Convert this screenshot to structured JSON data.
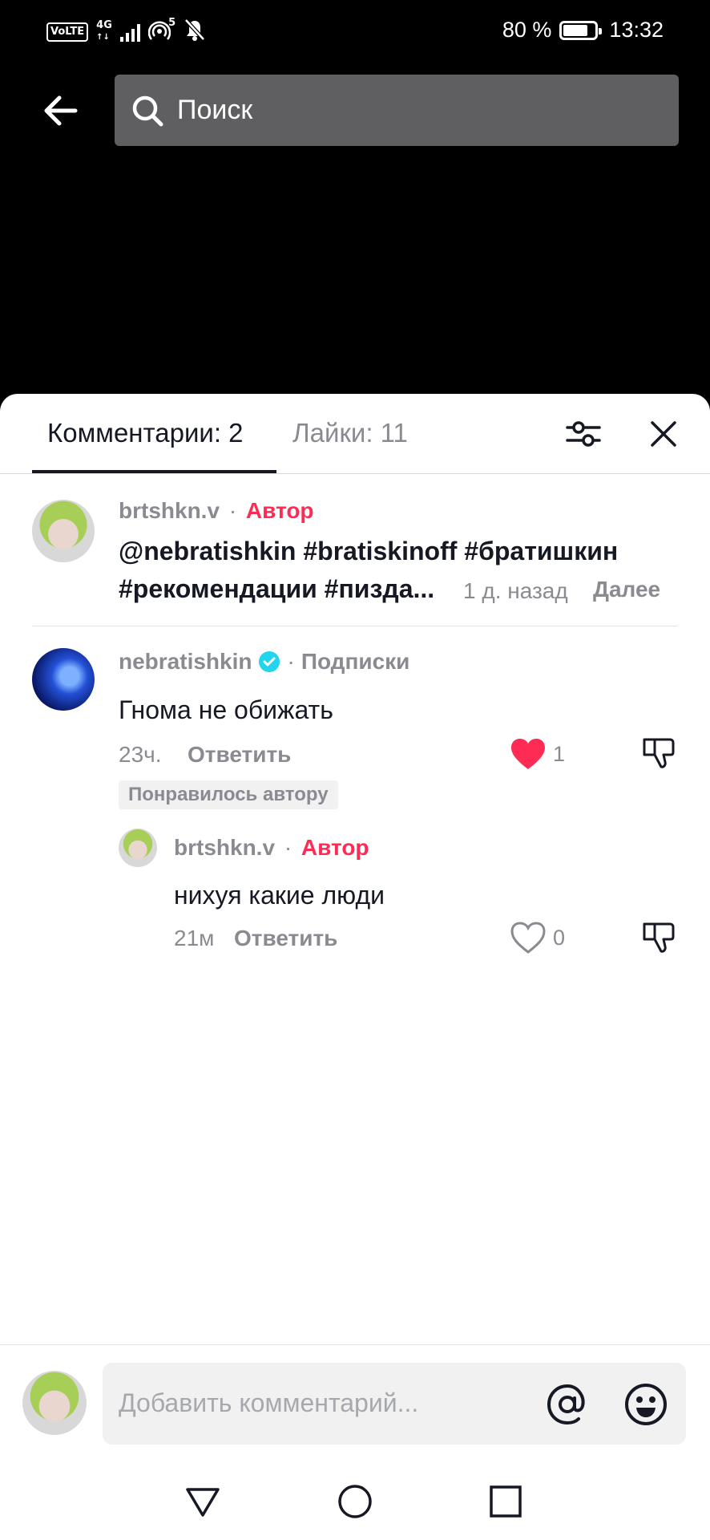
{
  "status_bar": {
    "volte": "VoLTE",
    "network": "4G",
    "hotspot_count": "5",
    "battery_percent": "80 %",
    "time": "13:32"
  },
  "search": {
    "placeholder": "Поиск"
  },
  "tabs": {
    "comments": "Комментарии: 2",
    "likes": "Лайки: 11"
  },
  "caption": {
    "username": "brtshkn.v",
    "separator": "·",
    "author_label": "Автор",
    "line1": "@nebratishkin #bratiskinoff #братишкин",
    "line2": "#рекомендации #пизда...",
    "time": "1 д. назад",
    "more": "Далее"
  },
  "comments": [
    {
      "username": "nebratishkin",
      "verified": true,
      "separator": "·",
      "relation": "Подписки",
      "text": "Гнома не обижать",
      "time": "23ч.",
      "reply_label": "Ответить",
      "likes": "1",
      "liked": true,
      "liked_by_author": "Понравилось автору",
      "replies": [
        {
          "username": "brtshkn.v",
          "separator": "·",
          "author_label": "Автор",
          "text": "нихуя какие люди",
          "time": "21м",
          "reply_label": "Ответить",
          "likes": "0",
          "liked": false
        }
      ]
    }
  ],
  "input": {
    "placeholder": "Добавить комментарий..."
  },
  "colors": {
    "accent": "#fe2c55",
    "verified": "#20d5ec",
    "muted": "#8a8b91"
  },
  "icons": [
    "back-arrow-icon",
    "search-icon",
    "filter-icon",
    "close-icon",
    "verified-icon",
    "heart-icon",
    "dislike-icon",
    "mention-icon",
    "emoji-icon",
    "nav-back-icon",
    "nav-home-icon",
    "nav-recents-icon"
  ]
}
